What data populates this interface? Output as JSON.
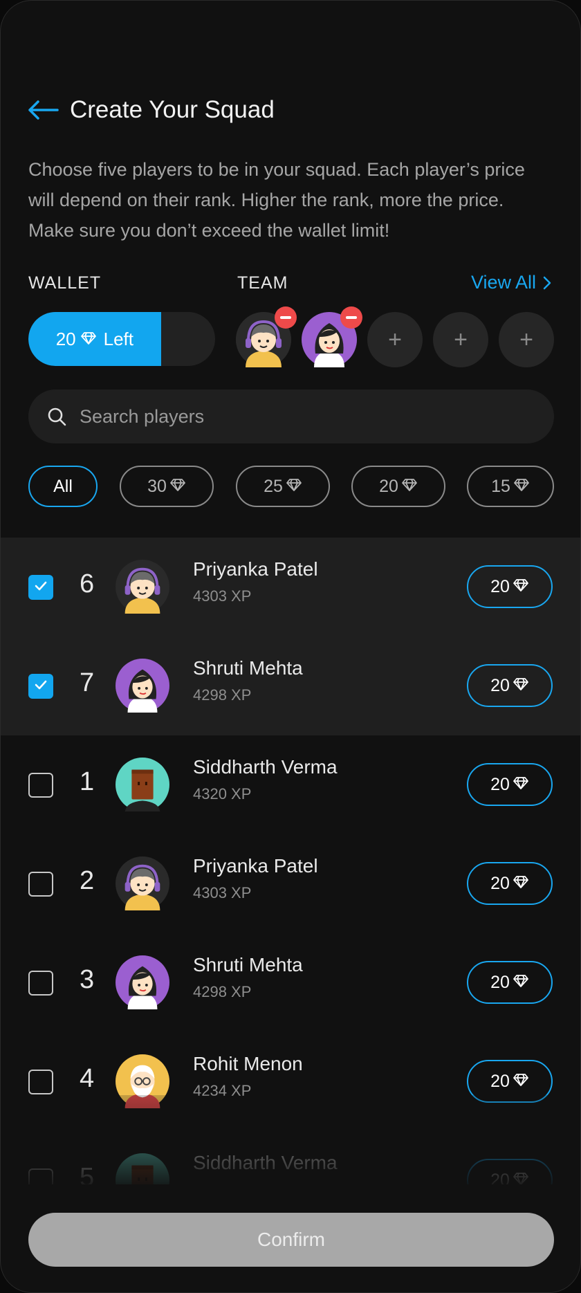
{
  "header": {
    "title": "Create Your Squad"
  },
  "description": "Choose five players to be in your squad. Each player’s price will depend on their rank. Higher the rank, more the price. Make sure you don’t exceed the wallet limit!",
  "wallet": {
    "label": "WALLET",
    "text": "20",
    "suffix": "Left",
    "fill_fraction": 0.71
  },
  "team": {
    "label": "TEAM",
    "view_all": "View All",
    "selected_avatars": [
      "headset-avatar",
      "purple-hair-avatar"
    ],
    "empty_slots": 3
  },
  "search": {
    "placeholder": "Search players"
  },
  "filters": [
    {
      "label": "All",
      "active": true
    },
    {
      "label": "30",
      "active": false
    },
    {
      "label": "25",
      "active": false
    },
    {
      "label": "20",
      "active": false
    },
    {
      "label": "15",
      "active": false
    }
  ],
  "players": [
    {
      "rank": "6",
      "name": "Priyanka Patel",
      "xp": "4303 XP",
      "price": "20",
      "checked": true,
      "avatar": "headset-avatar"
    },
    {
      "rank": "7",
      "name": "Shruti Mehta",
      "xp": "4298 XP",
      "price": "20",
      "checked": true,
      "avatar": "purple-hair-avatar"
    },
    {
      "rank": "1",
      "name": "Siddharth Verma",
      "xp": "4320 XP",
      "price": "20",
      "checked": false,
      "avatar": "box-avatar"
    },
    {
      "rank": "2",
      "name": "Priyanka Patel",
      "xp": "4303 XP",
      "price": "20",
      "checked": false,
      "avatar": "headset-avatar"
    },
    {
      "rank": "3",
      "name": "Shruti Mehta",
      "xp": "4298 XP",
      "price": "20",
      "checked": false,
      "avatar": "purple-hair-avatar"
    },
    {
      "rank": "4",
      "name": "Rohit Menon",
      "xp": "4234 XP",
      "price": "20",
      "checked": false,
      "avatar": "old-man-avatar"
    },
    {
      "rank": "5",
      "name": "Siddharth Verma",
      "xp": "",
      "price": "20",
      "checked": false,
      "avatar": "box-avatar"
    }
  ],
  "confirm_label": "Confirm",
  "colors": {
    "accent": "#12a6ef",
    "background": "#111111",
    "danger": "#ee4a4a",
    "confirm_disabled": "#a8a8a8"
  }
}
